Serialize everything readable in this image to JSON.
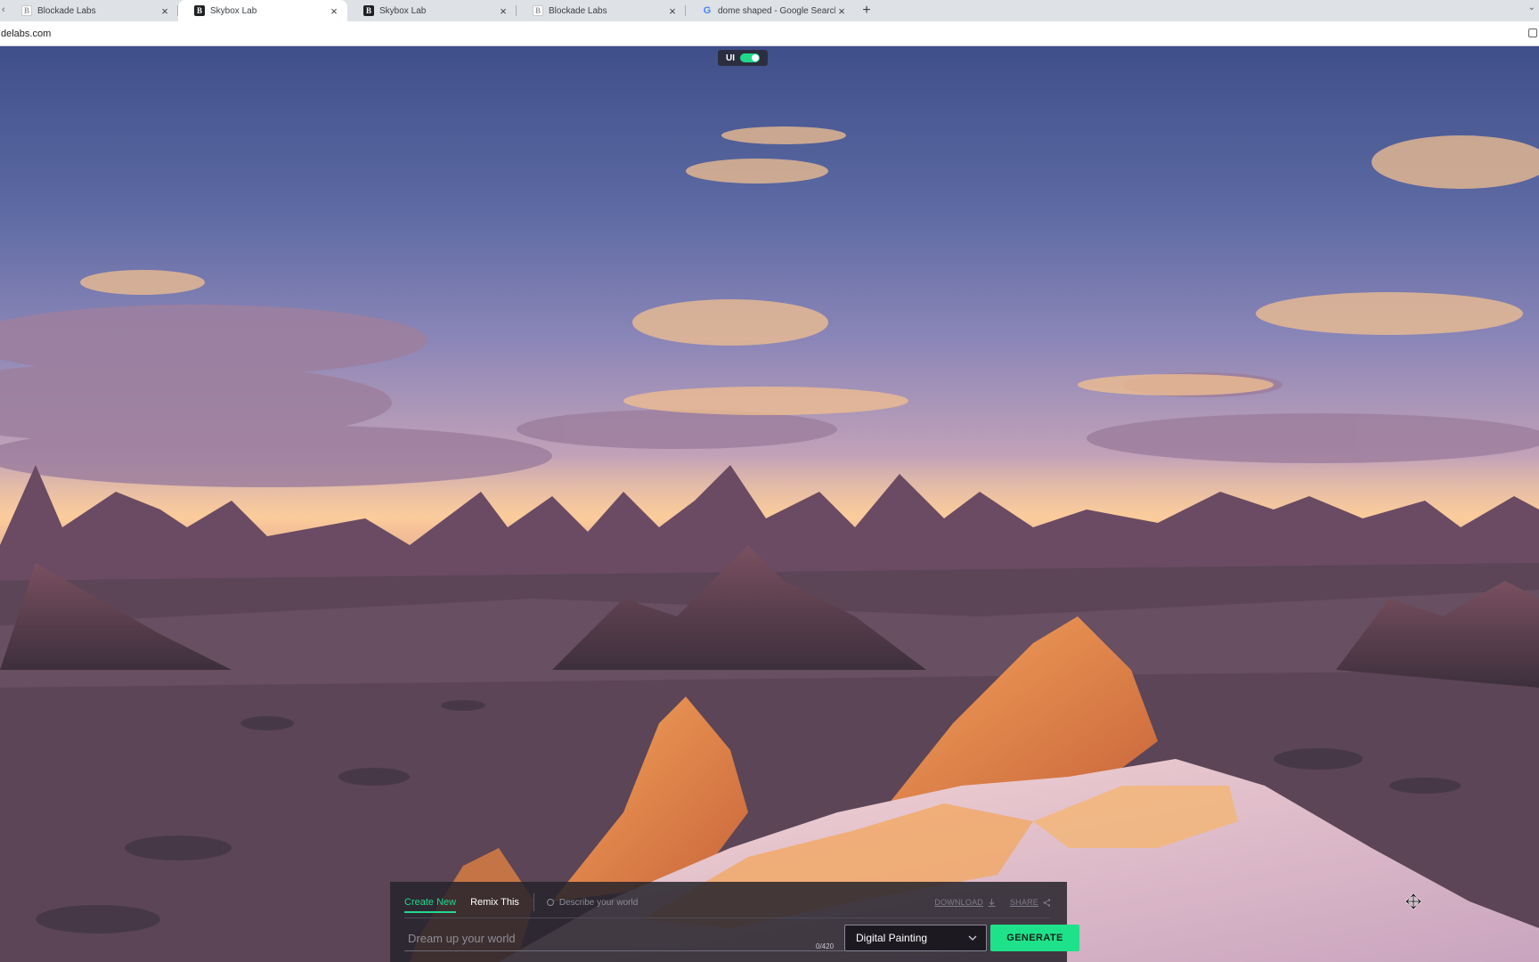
{
  "browser": {
    "tabs": [
      {
        "title": "Blockade Labs",
        "favicon": "blockade-light",
        "active": false
      },
      {
        "title": "Skybox Lab",
        "favicon": "blockade-dark",
        "active": true
      },
      {
        "title": "Skybox Lab",
        "favicon": "blockade-dark",
        "active": false
      },
      {
        "title": "Blockade Labs",
        "favicon": "blockade-light",
        "active": false
      },
      {
        "title": "dome shaped - Google Search",
        "favicon": "google",
        "active": false
      }
    ],
    "close_glyph": "×",
    "new_tab_glyph": "+",
    "url": "delabs.com"
  },
  "ui_toggle": {
    "label": "UI",
    "on": true
  },
  "panel": {
    "tabs": [
      {
        "label": "Create New",
        "active": true
      },
      {
        "label": "Remix This",
        "active": false
      }
    ],
    "hint": "Describe your world",
    "download_label": "DOWNLOAD",
    "share_label": "SHARE",
    "prompt_placeholder": "Dream up your world",
    "prompt_value": "",
    "counter": "0/420",
    "style_value": "Digital Painting",
    "generate_label": "GENERATE"
  },
  "colors": {
    "accent": "#1ee28a",
    "panel": "#26242c"
  }
}
